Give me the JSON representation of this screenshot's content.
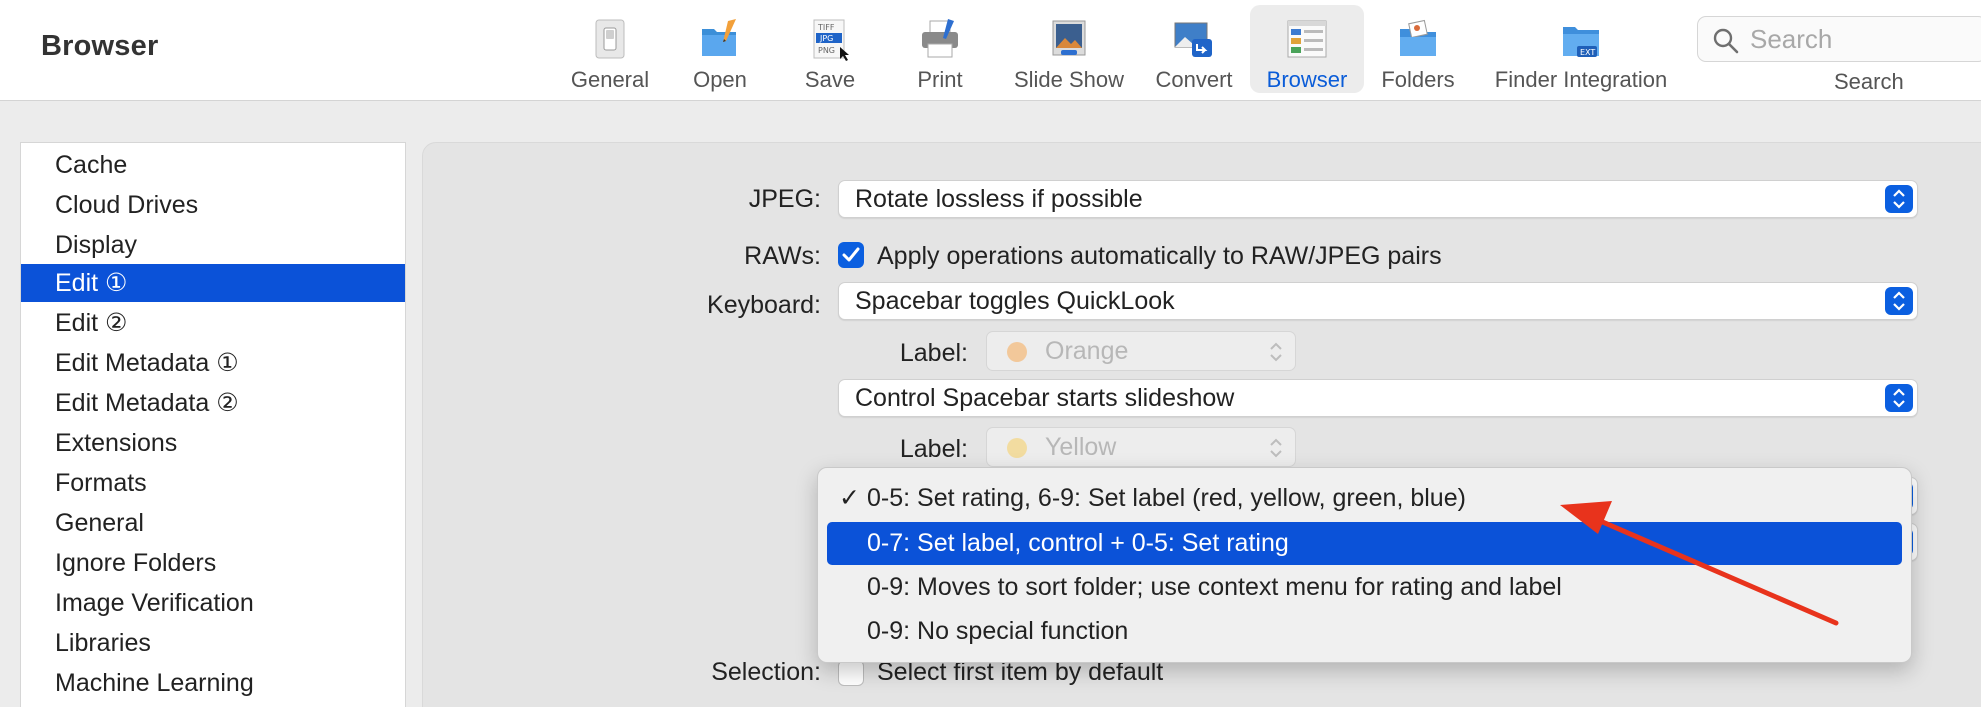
{
  "app": {
    "title": "Browser"
  },
  "toolbar": {
    "items": [
      {
        "label": "General",
        "icon": "general-switch-icon"
      },
      {
        "label": "Open",
        "icon": "open-folder-icon"
      },
      {
        "label": "Save",
        "icon": "save-formats-icon"
      },
      {
        "label": "Print",
        "icon": "printer-icon"
      },
      {
        "label": "Slide Show",
        "icon": "slideshow-icon"
      },
      {
        "label": "Convert",
        "icon": "convert-icon"
      },
      {
        "label": "Browser",
        "icon": "browser-window-icon",
        "active": true
      },
      {
        "label": "Folders",
        "icon": "folders-icon"
      },
      {
        "label": "Finder Integration",
        "icon": "finder-integration-icon"
      }
    ],
    "search": {
      "placeholder": "Search",
      "label": "Search"
    },
    "active_color": "#0a5cd8"
  },
  "sidebar": {
    "items": [
      {
        "label": "Cache"
      },
      {
        "label": "Cloud Drives"
      },
      {
        "label": "Display"
      },
      {
        "label": "Edit ①",
        "selected": true
      },
      {
        "label": "Edit ②"
      },
      {
        "label": "Edit Metadata ①"
      },
      {
        "label": "Edit Metadata ②"
      },
      {
        "label": "Extensions"
      },
      {
        "label": "Formats"
      },
      {
        "label": "General"
      },
      {
        "label": "Ignore Folders"
      },
      {
        "label": "Image Verification"
      },
      {
        "label": "Libraries"
      },
      {
        "label": "Machine Learning"
      }
    ],
    "selected_color": "#0b52d8"
  },
  "settings": {
    "jpeg": {
      "label": "JPEG:",
      "value": "Rotate lossless if possible"
    },
    "raws": {
      "label": "RAWs:",
      "checked": true,
      "text": "Apply operations automatically to RAW/JPEG pairs"
    },
    "keyboard": {
      "label": "Keyboard:",
      "value": "Spacebar toggles QuickLook"
    },
    "label1": {
      "label": "Label:",
      "value": "Orange",
      "color": "#f2c89a"
    },
    "control_spacebar": {
      "value": "Control Spacebar starts slideshow"
    },
    "label2": {
      "label": "Label:",
      "value": "Yellow",
      "color": "#f2dca0"
    },
    "selection": {
      "label": "Selection:",
      "checked": false,
      "text": "Select first item by default"
    }
  },
  "menu": {
    "items": [
      {
        "label": "0-5: Set rating, 6-9: Set label (red, yellow, green, blue)",
        "checked": true
      },
      {
        "label": "0-7: Set label, control + 0-5: Set rating",
        "highlighted": true
      },
      {
        "label": "0-9: Moves to sort folder; use context menu for rating and label"
      },
      {
        "label": "0-9: No special function"
      }
    ],
    "checkmark": "✓"
  },
  "annotation": {
    "arrow_color": "#e8331c"
  }
}
